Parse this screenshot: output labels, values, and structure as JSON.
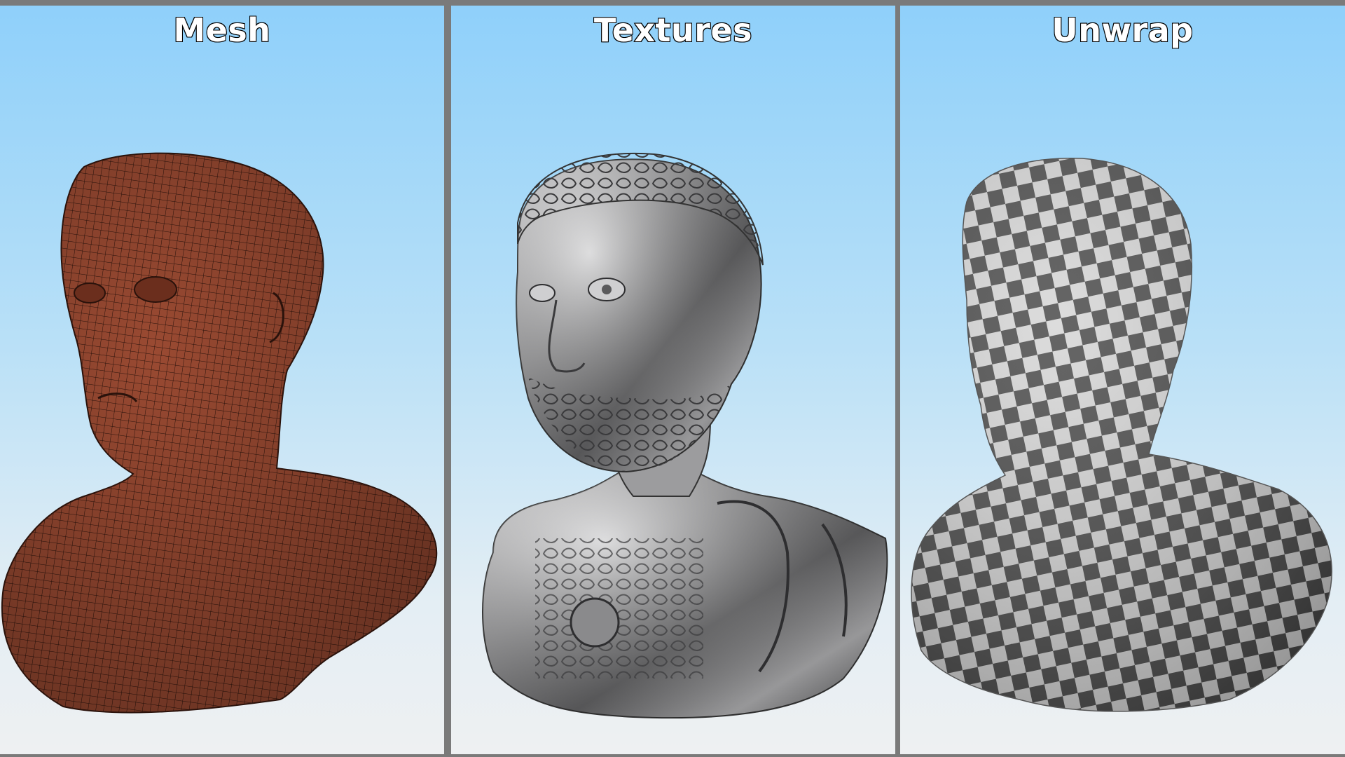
{
  "panels": [
    {
      "title": "Mesh",
      "render": "wireframe-bust",
      "base_color": "#9a4a32",
      "line_color": "#2a120b"
    },
    {
      "title": "Textures",
      "render": "silver-textured-bust",
      "base_color": "#a9a9ab",
      "highlight_color": "#f2f2f4",
      "shadow_color": "#2e2e30"
    },
    {
      "title": "Unwrap",
      "render": "checker-uv-bust",
      "checker_dark": "#4a4a4a",
      "checker_light": "#d6d6d6"
    }
  ],
  "colors": {
    "sky_top": "#8fd0fa",
    "sky_bottom": "#eef0f2",
    "divider": "#7a7a7a"
  }
}
